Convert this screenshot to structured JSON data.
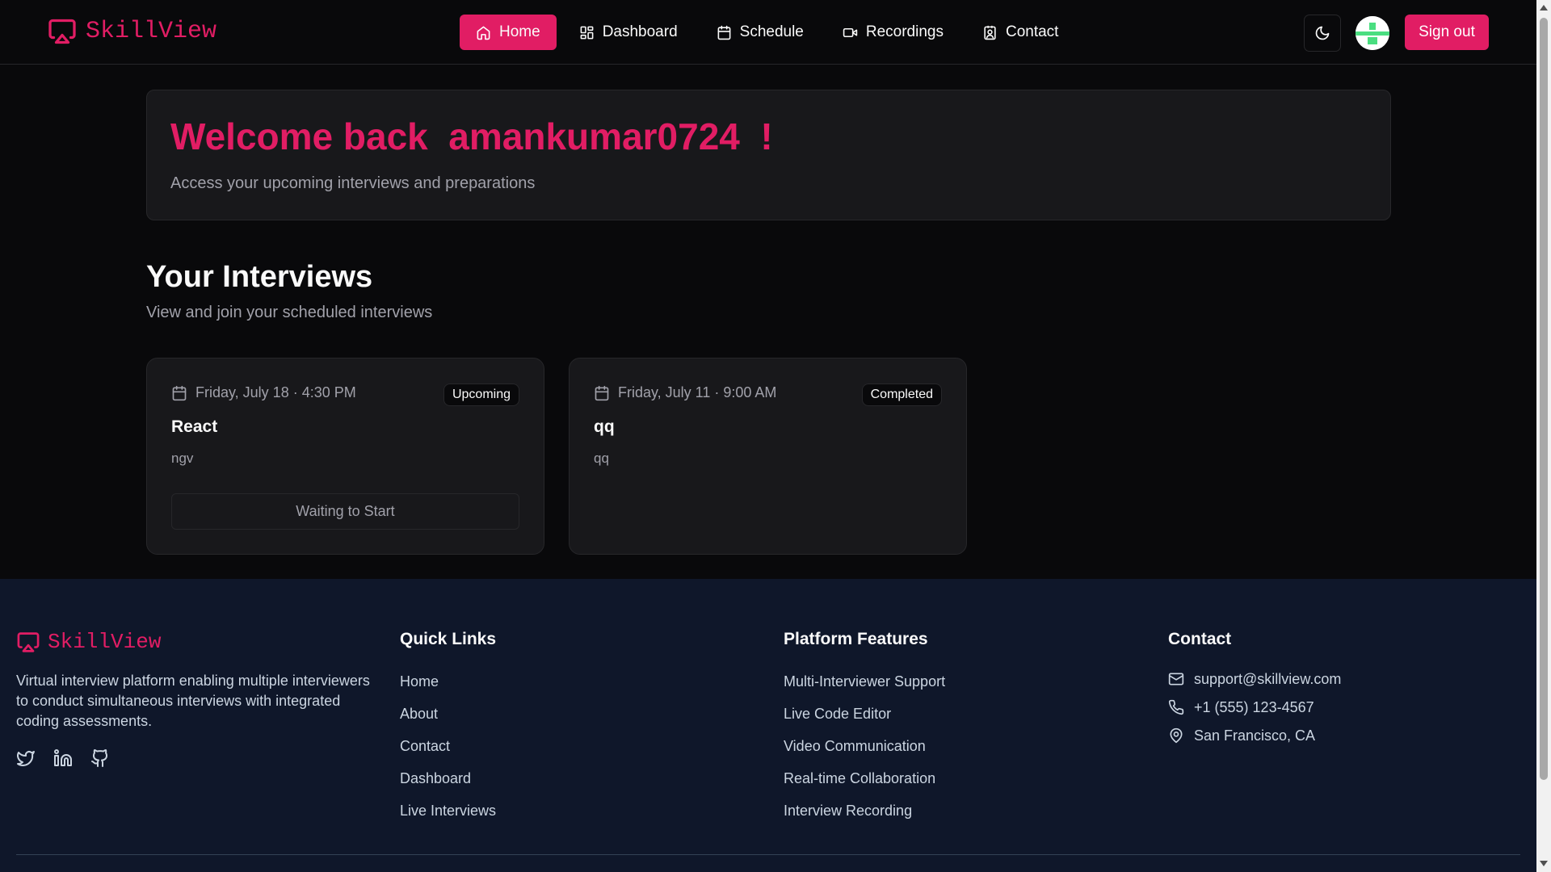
{
  "brand": {
    "name": "SkillView",
    "accent_color": "#e11d64"
  },
  "nav": {
    "items": [
      {
        "label": "Home",
        "icon": "home-icon",
        "active": true
      },
      {
        "label": "Dashboard",
        "icon": "dashboard-icon",
        "active": false
      },
      {
        "label": "Schedule",
        "icon": "calendar-icon",
        "active": false
      },
      {
        "label": "Recordings",
        "icon": "video-icon",
        "active": false
      },
      {
        "label": "Contact",
        "icon": "contact-icon",
        "active": false
      }
    ],
    "theme_toggle_icon": "moon-icon",
    "sign_out_label": "Sign out"
  },
  "welcome": {
    "title": "Welcome back  amankumar0724  !",
    "subtitle": "Access your upcoming interviews and preparations"
  },
  "interviews": {
    "title": "Your Interviews",
    "subtitle": "View and join your scheduled interviews",
    "cards": [
      {
        "date": "Friday, July 18 · 4:30 PM",
        "status": "Upcoming",
        "title": "React",
        "description": "ngv",
        "action": "Waiting to Start"
      },
      {
        "date": "Friday, July 11 · 9:00 AM",
        "status": "Completed",
        "title": "qq",
        "description": "qq"
      }
    ]
  },
  "footer": {
    "brand": "SkillView",
    "description": "Virtual interview platform enabling multiple interviewers to conduct simultaneous interviews with integrated coding assessments.",
    "social_icons": [
      "twitter-icon",
      "linkedin-icon",
      "github-icon"
    ],
    "quick_links": {
      "title": "Quick Links",
      "items": [
        "Home",
        "About",
        "Contact",
        "Dashboard",
        "Live Interviews"
      ]
    },
    "features": {
      "title": "Platform Features",
      "items": [
        "Multi-Interviewer Support",
        "Live Code Editor",
        "Video Communication",
        "Real-time Collaboration",
        "Interview Recording"
      ]
    },
    "contact": {
      "title": "Contact",
      "email": "support@skillview.com",
      "phone": "+1 (555) 123-4567",
      "location": "San Francisco, CA"
    }
  }
}
